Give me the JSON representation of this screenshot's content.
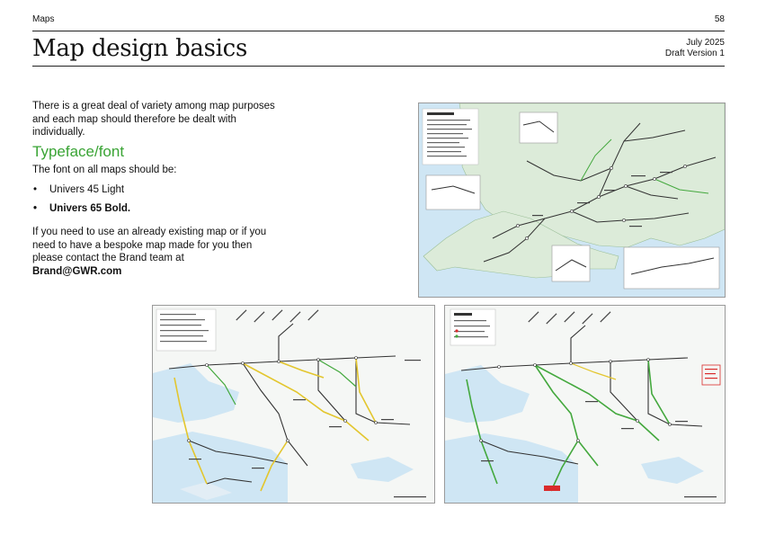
{
  "header": {
    "section": "Maps",
    "page_number": "58",
    "title": "Map design basics",
    "date": "July 2025",
    "version": "Draft Version 1"
  },
  "body": {
    "intro": "There is a great deal of variety among map purposes and each map should therefore be dealt with individually.",
    "subheading": "Typeface/font",
    "font_intro": "The font on all maps should be:",
    "fonts": [
      "Univers 45 Light",
      "Univers 65 Bold."
    ],
    "contact_text": "If you need to use an already existing map or if you need to have a bespoke map made for you then please contact the Brand team at",
    "contact_email": "Brand@GWR.com"
  },
  "maps": [
    {
      "name": "geographic-network-map"
    },
    {
      "name": "schematic-network-map-yellow"
    },
    {
      "name": "schematic-network-map-green"
    }
  ],
  "colors": {
    "accent_green": "#3aa435",
    "route_line": "#333333",
    "route_highlight_green": "#43a83d",
    "route_highlight_yellow": "#e3c62e",
    "sea": "#cfe6f4",
    "land": "#dcebd9",
    "schematic_background": "#f5f7f5",
    "alert_red": "#d92b2b"
  }
}
